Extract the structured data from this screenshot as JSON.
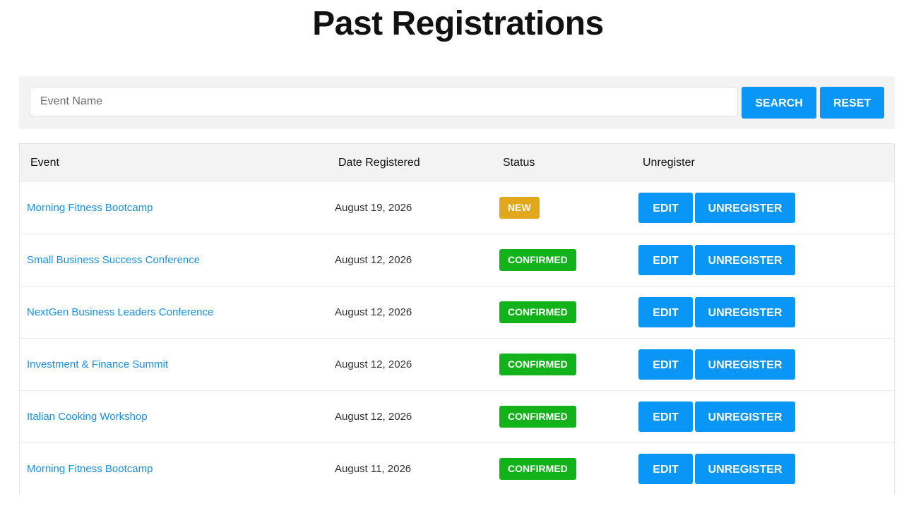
{
  "page": {
    "title": "Past Registrations"
  },
  "search": {
    "placeholder": "Event Name",
    "value": "",
    "search_label": "SEARCH",
    "reset_label": "RESET"
  },
  "table": {
    "columns": [
      "Event",
      "Date Registered",
      "Status",
      "Unregister"
    ],
    "rows": [
      {
        "event": "Morning Fitness Bootcamp",
        "date": "August 19, 2026",
        "status": "NEW",
        "edit_label": "EDIT",
        "unregister_label": "UNREGISTER"
      },
      {
        "event": "Small Business Success Conference",
        "date": "August 12, 2026",
        "status": "CONFIRMED",
        "edit_label": "EDIT",
        "unregister_label": "UNREGISTER"
      },
      {
        "event": "NextGen Business Leaders Conference",
        "date": "August 12, 2026",
        "status": "CONFIRMED",
        "edit_label": "EDIT",
        "unregister_label": "UNREGISTER"
      },
      {
        "event": "Investment & Finance Summit",
        "date": "August 12, 2026",
        "status": "CONFIRMED",
        "edit_label": "EDIT",
        "unregister_label": "UNREGISTER"
      },
      {
        "event": "Italian Cooking Workshop",
        "date": "August 12, 2026",
        "status": "CONFIRMED",
        "edit_label": "EDIT",
        "unregister_label": "UNREGISTER"
      },
      {
        "event": "Morning Fitness Bootcamp",
        "date": "August 11, 2026",
        "status": "CONFIRMED",
        "edit_label": "EDIT",
        "unregister_label": "UNREGISTER"
      }
    ]
  },
  "colors": {
    "primary_button": "#0a96f7",
    "link": "#1a8fe3",
    "badge_new": "#e0a81a",
    "badge_confirmed": "#12b31a",
    "toolbar_bg": "#f3f3f3"
  }
}
